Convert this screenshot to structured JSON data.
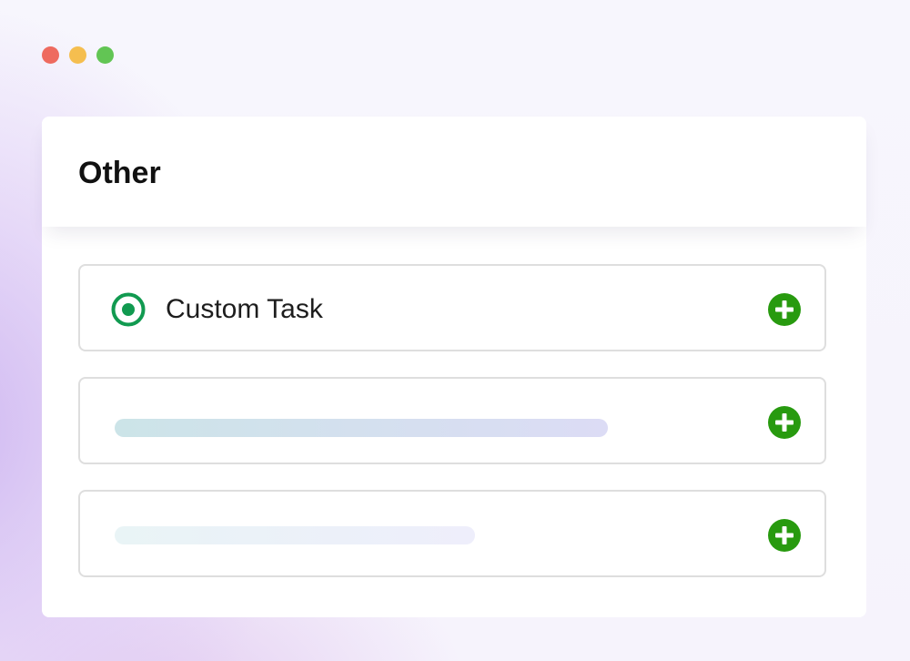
{
  "window_controls": {
    "close_color": "#ee6a5f",
    "minimize_color": "#f5be4f",
    "maximize_color": "#62c554"
  },
  "panel": {
    "title": "Other"
  },
  "tasks": [
    {
      "label": "Custom Task",
      "selected": true,
      "radio_icon": "radio-selected-icon",
      "add_icon": "plus-circle-icon"
    },
    {
      "label": "",
      "placeholder": true,
      "placeholder_colors": [
        "#cce4e8",
        "#dcdcf5"
      ],
      "add_icon": "plus-circle-icon"
    },
    {
      "label": "",
      "placeholder": true,
      "placeholder_colors": [
        "#e9f4f6",
        "#eeeefb"
      ],
      "add_icon": "plus-circle-icon"
    }
  ],
  "colors": {
    "accent_green": "#289a0f",
    "radio_green": "#119a50",
    "row_border": "#dedede"
  }
}
